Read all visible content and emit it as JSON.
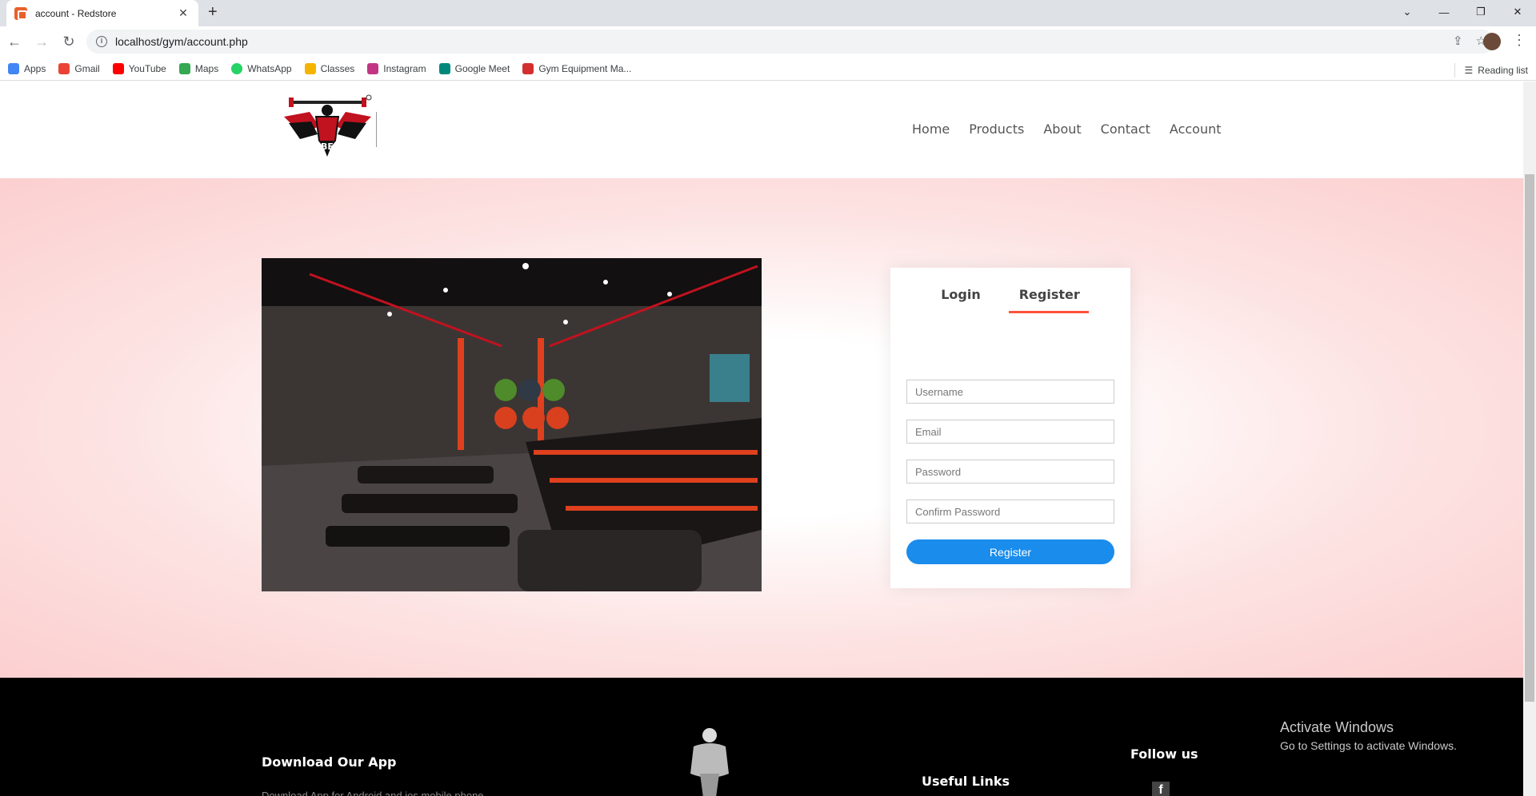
{
  "browser": {
    "tab_title": "account - Redstore",
    "new_tab": "+",
    "url": "localhost/gym/account.php",
    "bookmarks": [
      {
        "label": "Apps",
        "color": "#4285f4"
      },
      {
        "label": "Gmail",
        "color": "#ea4335"
      },
      {
        "label": "YouTube",
        "color": "#ff0000"
      },
      {
        "label": "Maps",
        "color": "#34a853"
      },
      {
        "label": "WhatsApp",
        "color": "#25d366"
      },
      {
        "label": "Classes",
        "color": "#f4b400"
      },
      {
        "label": "Instagram",
        "color": "#c13584"
      },
      {
        "label": "Google Meet",
        "color": "#00897b"
      },
      {
        "label": "Gym Equipment Ma...",
        "color": "#d32f2f"
      }
    ],
    "reading_list": "Reading list"
  },
  "nav": {
    "home": "Home",
    "products": "Products",
    "about": "About",
    "contact": "Contact",
    "account": "Account"
  },
  "form": {
    "tab_login": "Login",
    "tab_register": "Register",
    "username_placeholder": "Username",
    "email_placeholder": "Email",
    "password_placeholder": "Password",
    "confirm_placeholder": "Confirm Password",
    "submit_label": "Register"
  },
  "footer": {
    "download_title": "Download Our App",
    "download_text": "Download App for Android and ios mobile phone.",
    "useful_links_title": "Useful Links",
    "follow_title": "Follow us"
  },
  "os_watermark": {
    "line1": "Activate Windows",
    "line2": "Go to Settings to activate Windows."
  },
  "colors": {
    "accent": "#ff523b",
    "button": "#1a8cec"
  }
}
